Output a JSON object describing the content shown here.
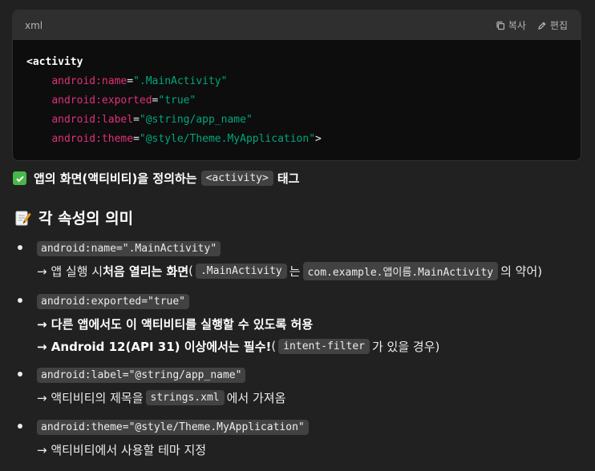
{
  "code_block": {
    "language": "xml",
    "copy_label": "복사",
    "edit_label": "편집",
    "lines": {
      "l0_tag": "<activity",
      "l1_attr": "android:name",
      "l1_val": "\".MainActivity\"",
      "l2_attr": "android:exported",
      "l2_val": "\"true\"",
      "l3_attr": "android:label",
      "l3_val": "\"@string/app_name\"",
      "l4_attr": "android:theme",
      "l4_val": "\"@style/Theme.MyApplication\"",
      "l4_close": ">"
    }
  },
  "summary": {
    "icon": "check-mark-icon",
    "text_before": "앱의 화면(액티비티)을 정의하는",
    "code": "<activity>",
    "text_after": "태그"
  },
  "section": {
    "icon": "memo-icon",
    "title": "각 속성의 의미"
  },
  "items": [
    {
      "key": "android:name=\".MainActivity\"",
      "desc_prefix": "→ 앱 실행 시 ",
      "desc_bold": "처음 열리는 화면",
      "desc_mid": " (",
      "code1": ".MainActivity",
      "desc_mid2": "는",
      "code2": "com.example.앱이름.MainActivity",
      "desc_suffix": "의 약어)"
    },
    {
      "key": "android:exported=\"true\"",
      "line1": "→ 다른 앱에서도 이 액티비티를 실행할 수 있도록 허용",
      "line2_bold": "→ Android 12(API 31) 이상에서는 필수!",
      "line2_mid": " (",
      "code": "intent-filter",
      "line2_suffix": "가 있을 경우)"
    },
    {
      "key": "android:label=\"@string/app_name\"",
      "desc_prefix": "→ 액티비티의 제목을",
      "code": "strings.xml",
      "desc_suffix": "에서 가져옴"
    },
    {
      "key": "android:theme=\"@style/Theme.MyApplication\"",
      "desc": "→ 액티비티에서 사용할 테마 지정"
    }
  ]
}
